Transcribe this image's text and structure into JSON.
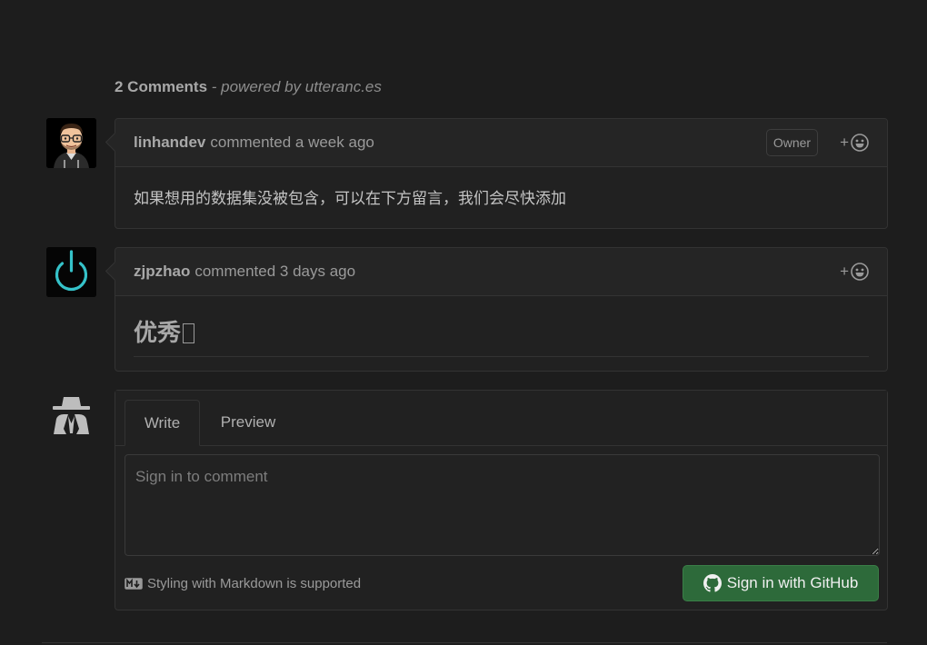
{
  "header": {
    "count_label": "2 Comments",
    "powered_label": "- powered by utteranc.es"
  },
  "comments": [
    {
      "author": "linhandev",
      "meta": "commented a week ago",
      "badge": "Owner",
      "reaction_label": "+",
      "body": "如果想用的数据集没被包含，可以在下方留言，我们会尽快添加"
    },
    {
      "author": "zjpzhao",
      "meta": "commented 3 days ago",
      "reaction_label": "+",
      "body": "优秀"
    }
  ],
  "composer": {
    "tab_write": "Write",
    "tab_preview": "Preview",
    "placeholder": "Sign in to comment",
    "markdown_note": "Styling with Markdown is supported",
    "signin_label": "Sign in with GitHub"
  },
  "icons": {
    "avatar_1": "cartoon-man-with-glasses-avatar",
    "avatar_2": "power-icon-avatar",
    "anonymous": "anonymous-user-icon",
    "reaction": "smiley-face-icon",
    "markdown": "markdown-icon",
    "github": "github-mark-icon"
  },
  "colors": {
    "background": "#1d1d1d",
    "panel": "#212121",
    "border": "#333333",
    "button_green": "#2d6a3a",
    "power_teal": "#35c2c9"
  }
}
